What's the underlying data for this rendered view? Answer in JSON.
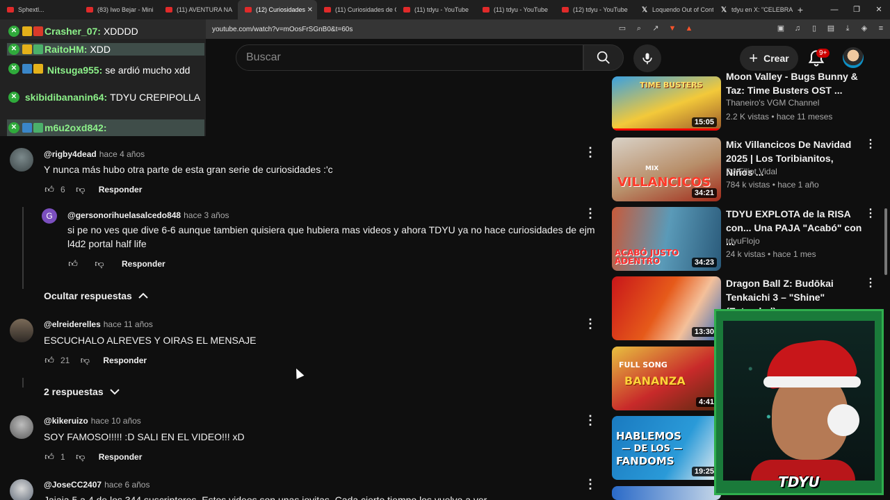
{
  "browser": {
    "tabs": [
      {
        "title": "Sphextl...",
        "icon": "youtube-icon"
      },
      {
        "title": "(83) Iwo Bejar - Mini",
        "icon": "youtube-icon"
      },
      {
        "title": "(11) AVENTURA NA",
        "icon": "youtube-icon"
      },
      {
        "title": "(12) Curiosidades",
        "icon": "youtube-icon",
        "active": true
      },
      {
        "title": "(11) Curiosidades de C",
        "icon": "youtube-icon"
      },
      {
        "title": "(11) tdyu - YouTube",
        "icon": "youtube-icon"
      },
      {
        "title": "(11) tdyu - YouTube",
        "icon": "youtube-icon"
      },
      {
        "title": "(12) tdyu - YouTube",
        "icon": "youtube-icon"
      },
      {
        "title": "Loquendo Out of Cont",
        "icon": "x-icon"
      },
      {
        "title": "tdyu en X: \"CELEBRAN",
        "icon": "x-icon"
      }
    ],
    "url": "youtube.com/watch?v=mOosFrSGnB0&t=60s"
  },
  "header": {
    "search_placeholder": "Buscar",
    "create_label": "Crear",
    "notif_badge": "9+"
  },
  "chat": {
    "messages": [
      {
        "user": "Crasher_07:",
        "text": "XDDDD"
      },
      {
        "user": "RaitoHM:",
        "text": "XDD"
      },
      {
        "user": "Nitsuga955:",
        "text": "se ardió mucho xdd"
      },
      {
        "user": "skibidibananin64:",
        "text": "TDYU CREPIPOLLA"
      },
      {
        "user": "m6u2oxd842:",
        "text": ""
      }
    ]
  },
  "comments": [
    {
      "handle": "@rigby4dead",
      "time": "hace 4 años",
      "text": "Y nunca más hubo otra parte de esta gran serie de curiosidades :'c",
      "likes": "6",
      "reply": "Responder"
    },
    {
      "handle": "@gersonorihuelasalcedo848",
      "time": "hace 3 años",
      "avatar_letter": "G",
      "text": "si pe no ves que dive 6-6 aunque tambien quisiera que hubiera mas videos y ahora TDYU ya no hace curiosidades de ejm l4d2 portal half life",
      "likes": "",
      "reply": "Responder"
    },
    {
      "handle": "@elreiderelles",
      "time": "hace 11 años",
      "text": "ESCUCHALO ALREVES Y OIRAS EL MENSAJE",
      "likes": "21",
      "reply": "Responder"
    },
    {
      "handle": "@kikeruizo",
      "time": "hace 10 años",
      "text": "SOY FAMOSO!!!!! :D SALI EN EL VIDEO!!! xD",
      "likes": "1",
      "reply": "Responder"
    },
    {
      "handle": "@JoseCC2407",
      "time": "hace 6 años",
      "text": "Jajaja 5 a 4 de los 344 suscriptores. Estos videos son unas joyitas. Cada cierto tiempo los vuelvo a ver",
      "likes": "",
      "reply": ""
    }
  ],
  "toggles": {
    "hide_replies": "Ocultar respuestas",
    "two_replies": "2 respuestas"
  },
  "sidebar": [
    {
      "title": "Moon Valley - Bugs Bunny & Taz: Time Busters OST ...",
      "channel": "Thaneiro's VGM Channel",
      "meta": "2.2 K vistas • hace 11 meses",
      "duration": "15:05"
    },
    {
      "title": "Mix Villancicos De Navidad 2025 | Los Toribianitos, Niños ...",
      "channel": "DJ Elliot Vidal",
      "meta": "784 k vistas • hace 1 año",
      "duration": "34:21"
    },
    {
      "title": "TDYU EXPLOTA de la RISA con... Una PAJA \"Acabó\" con ...",
      "channel": "tdyuFlojo",
      "meta": "24 k vistas • hace 1 mes",
      "duration": "34:23"
    },
    {
      "title": "Dragon Ball Z: Budōkai Tenkaichi 3 – \"Shine\" (Extended)",
      "channel": "",
      "meta": "",
      "duration": "13:30"
    },
    {
      "title": "",
      "channel": "",
      "meta": "",
      "duration": "4:41"
    },
    {
      "title": "",
      "channel": "",
      "meta": "",
      "duration": "19:25"
    }
  ],
  "thumb_text": {
    "t1": "TIME BUSTERS",
    "t2a": "MIX",
    "t2b": "VILLANCICOS",
    "t3": "ACABÓ JUSTO ADENTRO",
    "t5a": "FULL SONG",
    "t5b": "BANANZA",
    "t6a": "HABLEMOS",
    "t6b": "— DE LOS —",
    "t6c": "FANDOMS"
  },
  "cam": {
    "label": "TDYU"
  }
}
